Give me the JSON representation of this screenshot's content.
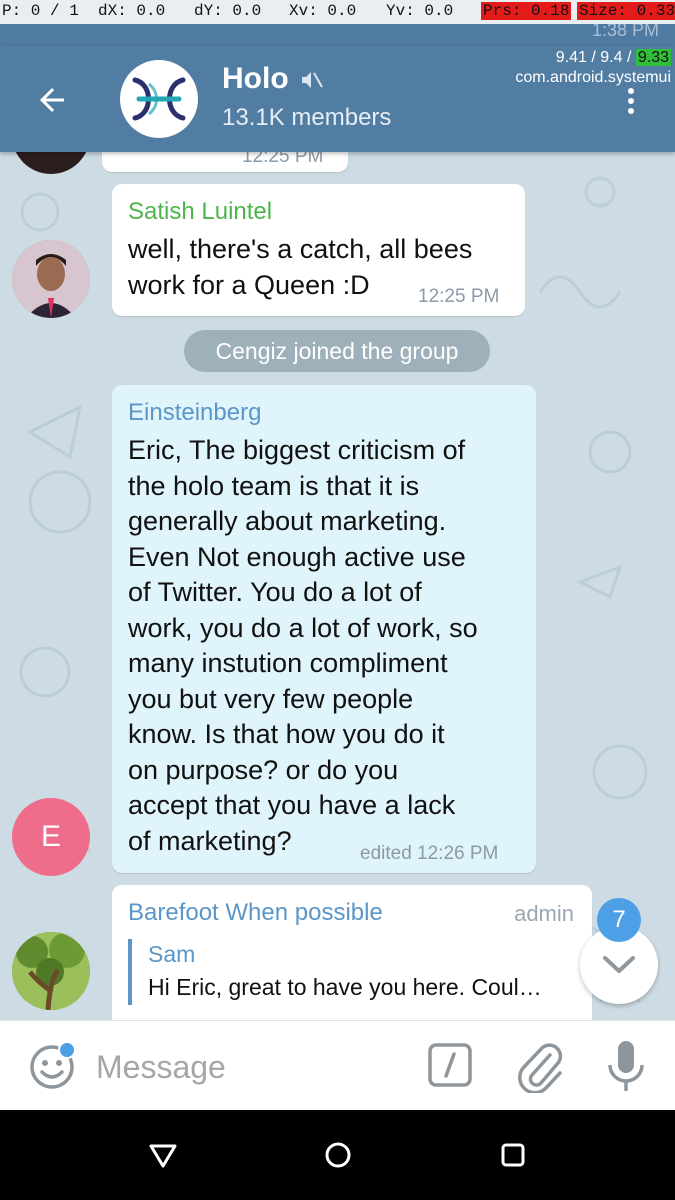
{
  "debug": {
    "p": "P: 0 / 1",
    "dx": "dX: 0.0",
    "dy": "dY: 0.0",
    "xv": "Xv: 0.0",
    "yv": "Yv: 0.0",
    "prs": "Prs: 0.18",
    "size": "Size: 0.33",
    "line2_a": "9.41 / 9.4 / ",
    "line2_b": "9.33",
    "line3": "com.android.systemui"
  },
  "status_bar": {
    "time": "1:38 PM"
  },
  "header": {
    "title": "Holo",
    "subtitle": "13.1K members",
    "muted_icon": "speaker-muted-icon",
    "back_icon": "arrow-left-icon",
    "menu_icon": "more-vertical-icon"
  },
  "messages": [
    {
      "partial_time": "12:25 PM"
    },
    {
      "sender": "Satish Luintel",
      "sender_color": "#4cb64a",
      "lines": [
        "well, there's a catch, all bees",
        "work for a Queen :D"
      ],
      "time": "12:25 PM"
    },
    {
      "service": "Cengiz joined the group"
    },
    {
      "sender": "Einsteinberg",
      "sender_color": "#5b96c7",
      "avatar_letter": "E",
      "avatar_color": "#ee6d8a",
      "lines": [
        "Eric, The biggest criticism of",
        "the holo team is that it is",
        "generally about marketing.",
        "Even Not enough active use",
        "of Twitter.  You do a lot of",
        "work, you do a lot of work, so",
        "many instution compliment",
        "you but very few people",
        "know.  Is that how you do it",
        "on purpose?  or do you",
        "accept that you have a lack",
        "of marketing?"
      ],
      "time": "edited 12:26 PM"
    },
    {
      "sender": "Barefoot When possible",
      "sender_color": "#5b96c7",
      "role": "admin",
      "reply_name": "Sam",
      "reply_text": "Hi Eric, great to have you here. Coul…"
    }
  ],
  "scroll_badge": "7",
  "compose": {
    "placeholder": "Message",
    "emoji_icon": "smiley-icon",
    "command_icon": "slash-command-icon",
    "attach_icon": "paperclip-icon",
    "mic_icon": "microphone-icon"
  },
  "colors": {
    "header": "#527da3",
    "accent": "#4d9fe6",
    "chat_bg": "#cddbe4"
  }
}
